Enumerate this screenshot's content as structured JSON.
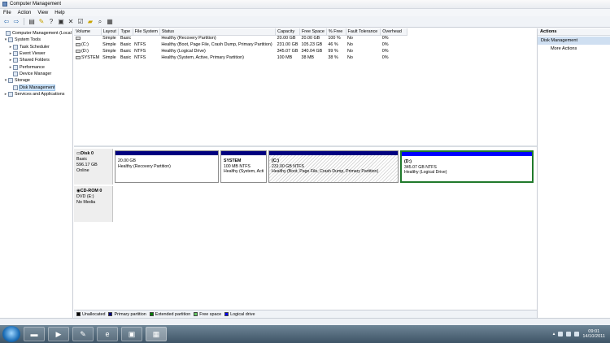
{
  "window": {
    "title": "Computer Management"
  },
  "menu": [
    "File",
    "Action",
    "View",
    "Help"
  ],
  "toolbar": {
    "icons": [
      "back-icon",
      "forward-icon",
      "up-folder-icon",
      "properties-icon",
      "help-icon",
      "show-hide-icon",
      "delete-icon",
      "check-icon",
      "open-icon",
      "search-icon",
      "disk-icon"
    ]
  },
  "tree": [
    {
      "label": "Computer Management (Local",
      "level": 0,
      "expander": "",
      "selected": false
    },
    {
      "label": "System Tools",
      "level": 1,
      "expander": "▾",
      "selected": false
    },
    {
      "label": "Task Scheduler",
      "level": 2,
      "expander": "▸",
      "selected": false
    },
    {
      "label": "Event Viewer",
      "level": 2,
      "expander": "▸",
      "selected": false
    },
    {
      "label": "Shared Folders",
      "level": 2,
      "expander": "▸",
      "selected": false
    },
    {
      "label": "Performance",
      "level": 2,
      "expander": "▸",
      "selected": false
    },
    {
      "label": "Device Manager",
      "level": 2,
      "expander": "",
      "selected": false
    },
    {
      "label": "Storage",
      "level": 1,
      "expander": "▾",
      "selected": false
    },
    {
      "label": "Disk Management",
      "level": 2,
      "expander": "",
      "selected": true
    },
    {
      "label": "Services and Applications",
      "level": 1,
      "expander": "▸",
      "selected": false
    }
  ],
  "volumes": {
    "columns": [
      "Volume",
      "Layout",
      "Type",
      "File System",
      "Status",
      "Capacity",
      "Free Space",
      "% Free",
      "Fault Tolerance",
      "Overhead"
    ],
    "rows": [
      [
        "",
        "Simple",
        "Basic",
        "",
        "Healthy (Recovery Partition)",
        "20.00 GB",
        "20.00 GB",
        "100 %",
        "No",
        "0%"
      ],
      [
        "(C:)",
        "Simple",
        "Basic",
        "NTFS",
        "Healthy (Boot, Page File, Crash Dump, Primary Partition)",
        "231.00 GB",
        "105.23 GB",
        "46 %",
        "No",
        "0%"
      ],
      [
        "(D:)",
        "Simple",
        "Basic",
        "NTFS",
        "Healthy (Logical Drive)",
        "345.07 GB",
        "340.04 GB",
        "99 %",
        "No",
        "0%"
      ],
      [
        "SYSTEM",
        "Simple",
        "Basic",
        "NTFS",
        "Healthy (System, Active, Primary Partition)",
        "100 MB",
        "38 MB",
        "38 %",
        "No",
        "0%"
      ]
    ]
  },
  "disks": [
    {
      "name": "Disk 0",
      "type": "Basic",
      "size": "596.17 GB",
      "status": "Online",
      "partitions": [
        {
          "name": "",
          "size": "20.00 GB",
          "status": "Healthy (Recovery Partition)",
          "kind": "primary",
          "hatched": false,
          "selected": false
        },
        {
          "name": "SYSTEM",
          "size": "100 MB NTFS",
          "status": "Healthy (System, Acti",
          "kind": "primary",
          "hatched": false,
          "selected": false
        },
        {
          "name": "(C:)",
          "size": "231.00 GB NTFS",
          "status": "Healthy (Boot, Page File, Crash Dump, Primary Partition)",
          "kind": "primary",
          "hatched": true,
          "selected": false
        },
        {
          "name": "(D:)",
          "size": "345.07 GB NTFS",
          "status": "Healthy (Logical Drive)",
          "kind": "logical",
          "hatched": false,
          "selected": true
        }
      ]
    },
    {
      "name": "CD-ROM 0",
      "type": "DVD (E:)",
      "size": "",
      "status": "No Media",
      "partitions": []
    }
  ],
  "legend": [
    {
      "label": "Unallocated",
      "color": "#000000"
    },
    {
      "label": "Primary partition",
      "color": "#00007f"
    },
    {
      "label": "Extended partition",
      "color": "#007f00"
    },
    {
      "label": "Free space",
      "color": "#66cc66"
    },
    {
      "label": "Logical drive",
      "color": "#0000ff"
    }
  ],
  "actions": {
    "header": "Actions",
    "section": "Disk Management",
    "items": [
      "More Actions"
    ]
  },
  "taskbar": {
    "apps": [
      "explorer-icon",
      "media-player-icon",
      "paint-icon",
      "internet-explorer-icon",
      "remote-desktop-icon",
      "computer-management-icon"
    ],
    "time": "09:01",
    "date": "14/10/2011"
  }
}
